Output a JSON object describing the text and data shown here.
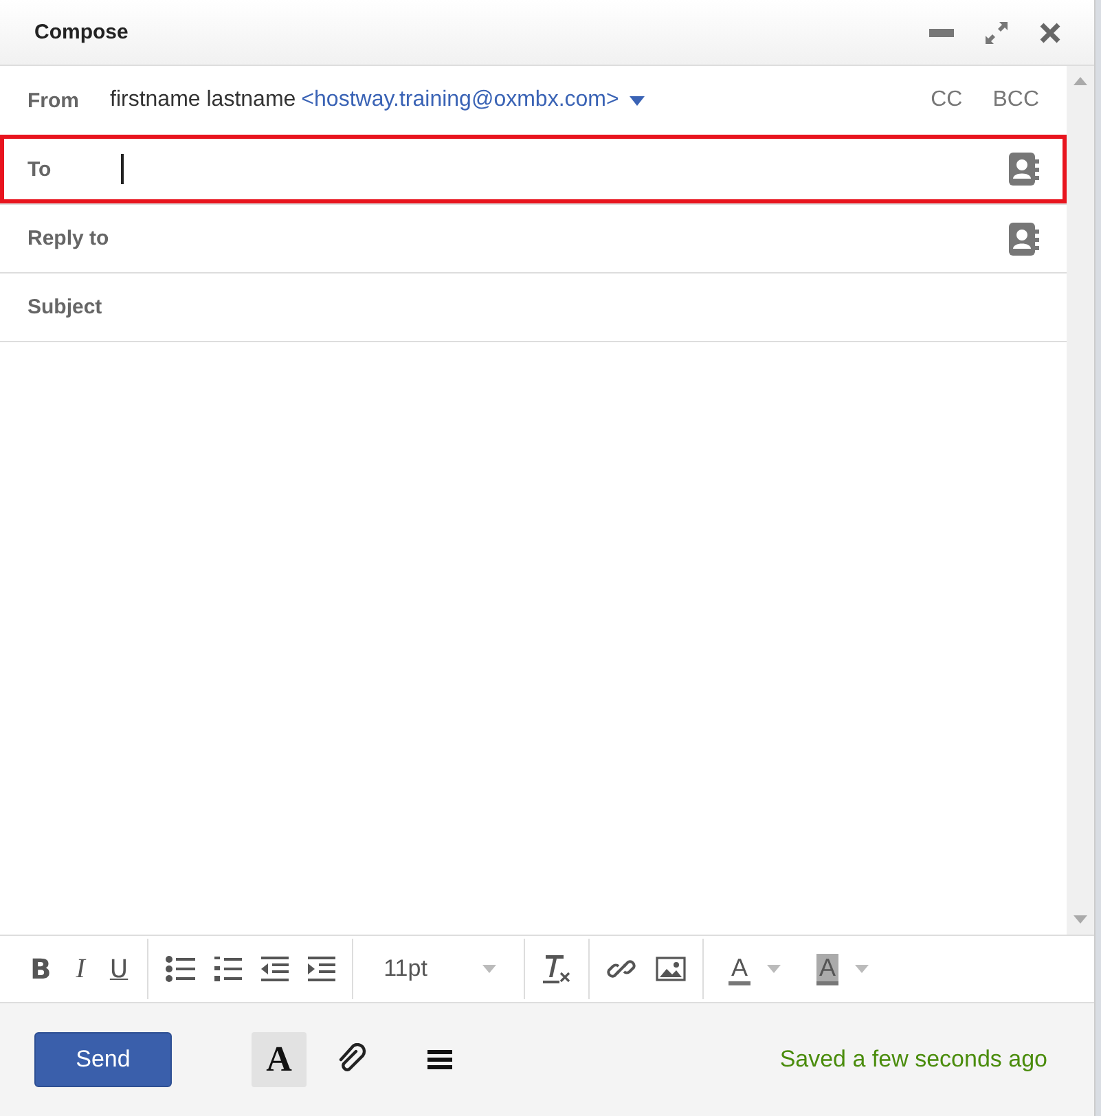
{
  "window": {
    "title": "Compose"
  },
  "from": {
    "label": "From",
    "name": "firstname lastname",
    "address": "<hostway.training@oxmbx.com>",
    "links": [
      "CC",
      "BCC"
    ]
  },
  "to": {
    "label": "To",
    "highlighted": true,
    "focused": true
  },
  "reply_to": {
    "label": "Reply to"
  },
  "subject": {
    "label": "Subject"
  },
  "toolbar": {
    "groups": [
      [
        {
          "kind": "bold",
          "glyph": "B"
        },
        {
          "kind": "italic",
          "glyph": "I"
        },
        {
          "kind": "underline",
          "glyph": "U"
        }
      ],
      [
        {
          "kind": "bullets"
        },
        {
          "kind": "numbers"
        },
        {
          "kind": "outdent"
        },
        {
          "kind": "indent"
        }
      ],
      [
        {
          "kind": "font_size",
          "value": "11pt"
        }
      ],
      [
        {
          "kind": "clear_format"
        }
      ],
      [
        {
          "kind": "link"
        },
        {
          "kind": "image"
        }
      ],
      [
        {
          "kind": "font_color",
          "glyph": "A"
        },
        {
          "kind": "highlight_color",
          "glyph": "A"
        }
      ]
    ]
  },
  "footer": {
    "send": "Send",
    "format_toggle": {
      "glyph": "A",
      "selected": true
    },
    "status": "Saved a few seconds ago"
  }
}
